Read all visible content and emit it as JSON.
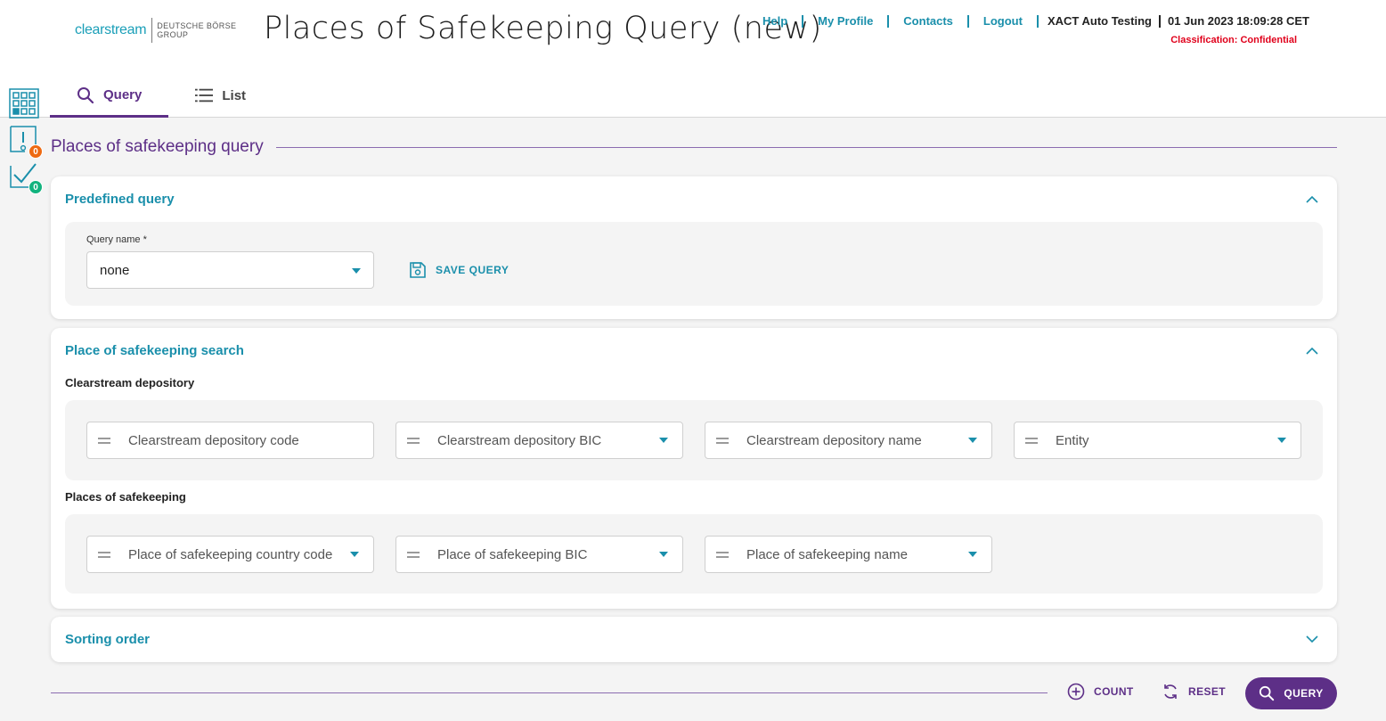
{
  "header": {
    "logo_main": "clearstream",
    "logo_sub_line1": "DEUTSCHE BÖRSE",
    "logo_sub_line2": "GROUP",
    "title": "Places of Safekeeping Query (new)",
    "links": {
      "help": "Help",
      "profile": "My Profile",
      "contacts": "Contacts",
      "logout": "Logout"
    },
    "user": "XACT Auto Testing",
    "datetime": "01 Jun 2023 18:09:28 CET",
    "classification": "Classification: Confidential"
  },
  "tabs": {
    "query": "Query",
    "list": "List"
  },
  "rail": {
    "alerts_count": "0",
    "tasks_count": "0"
  },
  "section_title": "Places of safekeeping query",
  "predefined": {
    "title": "Predefined query",
    "query_name_label": "Query name *",
    "query_name_value": "none",
    "save_label": "SAVE QUERY"
  },
  "search": {
    "title": "Place of safekeeping search",
    "depository_label": "Clearstream depository",
    "depository_fields": {
      "code": "Clearstream depository code",
      "bic": "Clearstream depository BIC",
      "name": "Clearstream depository name",
      "entity": "Entity"
    },
    "places_label": "Places of safekeeping",
    "places_fields": {
      "country": "Place of safekeeping country code",
      "bic": "Place of safekeeping BIC",
      "name": "Place of safekeeping name"
    }
  },
  "sorting": {
    "title": "Sorting order"
  },
  "footer": {
    "count": "COUNT",
    "reset": "RESET",
    "query": "QUERY"
  },
  "colors": {
    "accent": "#5d2f87",
    "link": "#1a8fab",
    "alert": "#e0001b",
    "badge_orange": "#ee6a12",
    "badge_green": "#12b37e"
  }
}
